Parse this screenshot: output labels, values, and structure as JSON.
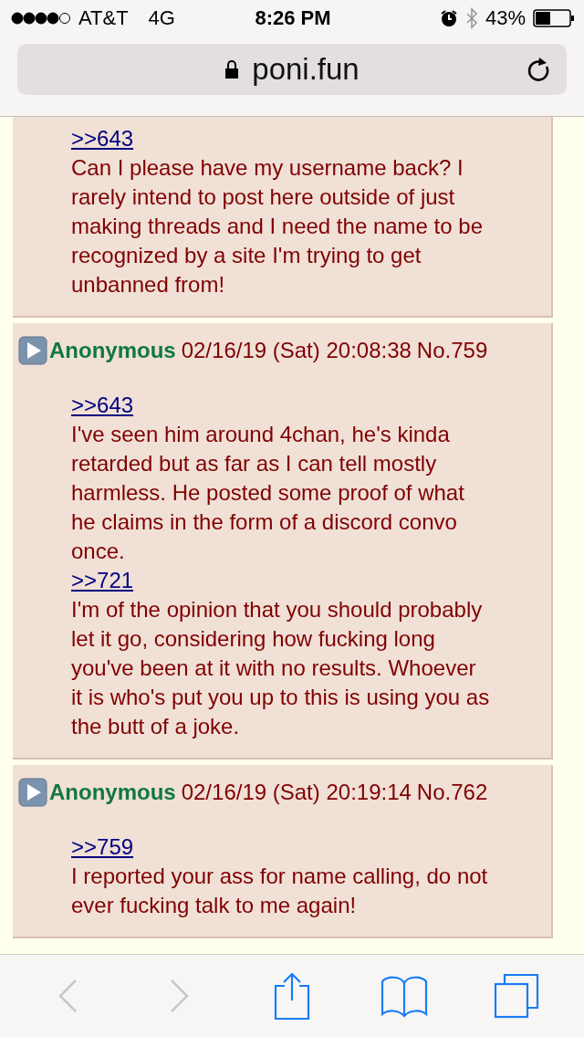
{
  "status_bar": {
    "carrier": "AT&T",
    "network": "4G",
    "time": "8:26 PM",
    "battery": "43%"
  },
  "address_bar": {
    "url": "poni.fun"
  },
  "posts": [
    {
      "paragraphs": [
        {
          "quote": ">>643",
          "text": "Can I please have my username back? I rarely intend to post here outside of just making threads and I need the name to be recognized by a site I'm trying to get unbanned from!"
        }
      ]
    },
    {
      "header": {
        "name": "Anonymous",
        "datetime": "02/16/19 (Sat) 20:08:38",
        "number": "No.759"
      },
      "paragraphs": [
        {
          "quote": ">>643",
          "text": "I've seen him around 4chan, he's kinda retarded but as far as I can tell mostly harmless. He posted some proof of what he claims in the form of a discord convo once."
        },
        {
          "quote": ">>721",
          "text": "I'm of the opinion that you should probably let it go, considering how fucking long you've been at it with no results. Whoever it is who's put you up to this is using you as the butt of a joke."
        }
      ]
    },
    {
      "header": {
        "name": "Anonymous",
        "datetime": "02/16/19 (Sat) 20:19:14",
        "number": "No.762"
      },
      "paragraphs": [
        {
          "quote": ">>759",
          "text": "I reported your ass for name calling, do not ever fucking talk to me again!"
        }
      ]
    }
  ],
  "toolbar": [
    {
      "kind": "back",
      "disabled": true
    },
    {
      "kind": "forward",
      "disabled": true
    },
    {
      "kind": "share",
      "disabled": false
    },
    {
      "kind": "bookmarks",
      "disabled": false
    },
    {
      "kind": "tabs",
      "disabled": false
    }
  ]
}
